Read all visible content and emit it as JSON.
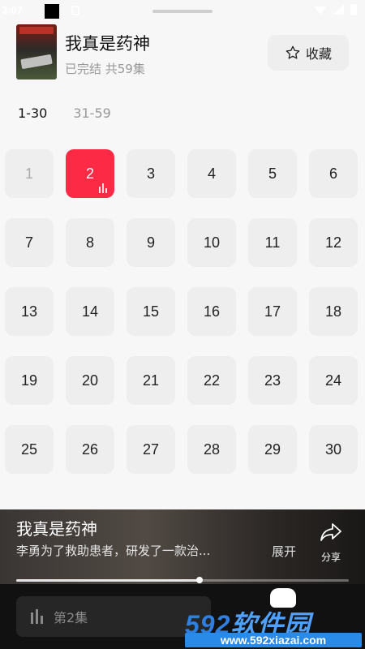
{
  "status_bar": {
    "time": "3:07"
  },
  "drama": {
    "title": "我真是药神",
    "status": "已完结 共59集",
    "favorite_label": "收藏"
  },
  "range_tabs": [
    {
      "label": "1-30",
      "active": true
    },
    {
      "label": "31-59",
      "active": false
    }
  ],
  "episodes": [
    "1",
    "2",
    "3",
    "4",
    "5",
    "6",
    "7",
    "8",
    "9",
    "10",
    "11",
    "12",
    "13",
    "14",
    "15",
    "16",
    "17",
    "18",
    "19",
    "20",
    "21",
    "22",
    "23",
    "24",
    "25",
    "26",
    "27",
    "28",
    "29",
    "30"
  ],
  "watched_episode": "1",
  "current_episode": "2",
  "player": {
    "title": "我真是药神",
    "description": "李勇为了救助患者，研发了一款治...",
    "expand_label": "展开",
    "share_label": "分享",
    "progress": 0.55
  },
  "bottom_bar": {
    "episode_label": "第2集"
  },
  "watermark": {
    "brand_number": "592",
    "brand_text": "软件园",
    "url": "www.592xiazai.com"
  },
  "colors": {
    "accent": "#fd2a45",
    "tile": "#eeeeee",
    "background": "#f7f7f7",
    "watermark_blue": "#2a8ae8"
  },
  "icons": {
    "favorite": "star-icon",
    "share": "share-arrow-icon",
    "playing": "equalizer-bars-icon"
  }
}
